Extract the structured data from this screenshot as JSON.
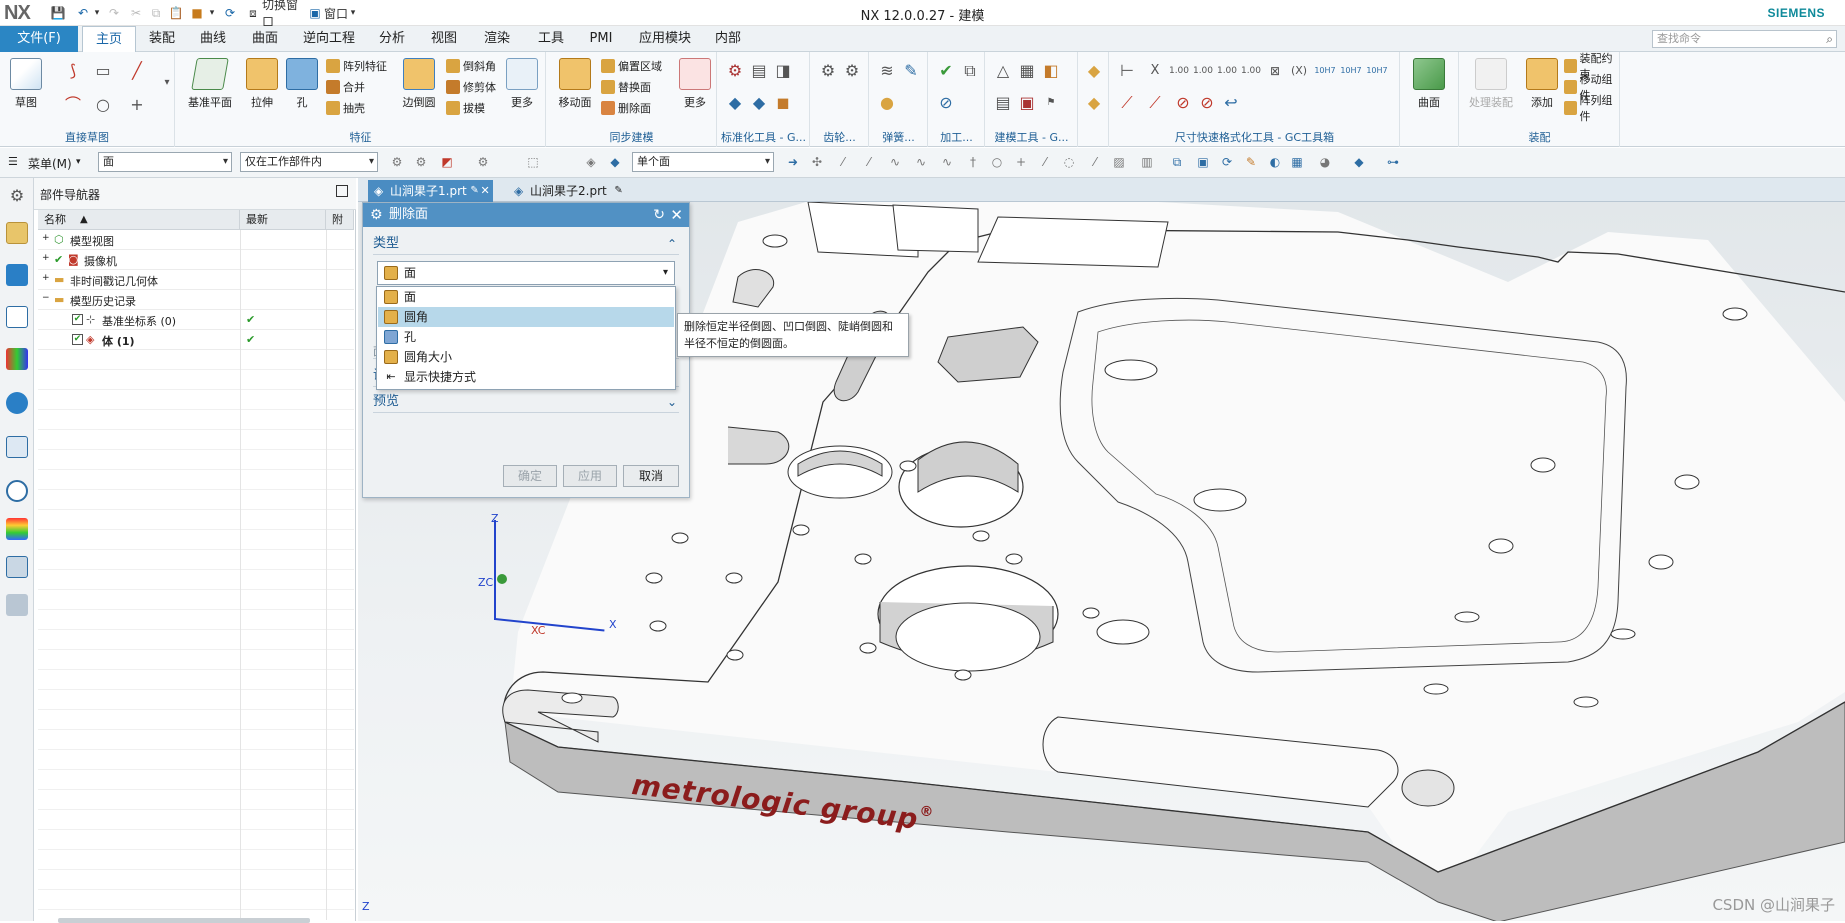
{
  "titlebar": {
    "logo": "NX",
    "switch_window": "切换窗口",
    "window": "窗口",
    "title": "NX 12.0.0.27 - 建模",
    "brand": "SIEMENS"
  },
  "menubar": {
    "file": "文件(F)",
    "tabs": [
      "主页",
      "装配",
      "曲线",
      "曲面",
      "逆向工程",
      "分析",
      "视图",
      "渲染",
      "工具",
      "PMI",
      "应用模块",
      "内部"
    ],
    "search_placeholder": "查找命令"
  },
  "ribbon": {
    "direct_sketch": {
      "label": "直接草图",
      "sketch": "草图"
    },
    "feature": {
      "label": "特征",
      "datum_plane": "基准平面",
      "extrude": "拉伸",
      "hole": "孔",
      "pattern_feature": "阵列特征",
      "unite": "合并",
      "shell": "抽壳",
      "edge_blend": "边倒圆",
      "chamfer": "倒斜角",
      "trim_body": "修剪体",
      "draft": "拔模",
      "more": "更多"
    },
    "sync": {
      "label": "同步建模",
      "move_face": "移动面",
      "offset_region": "偏置区域",
      "replace_face": "替换面",
      "delete_face": "删除面",
      "more": "更多"
    },
    "groups": [
      "标准化工具 - G...",
      "齿轮...",
      "弹簧...",
      "加工...",
      "建模工具 - G...",
      "尺寸快速格式化工具 - GC工具箱"
    ],
    "surface": "曲面",
    "assembly": {
      "label": "装配",
      "process_assembly": "处理装配",
      "add": "添加",
      "assembly_constraint": "装配约束",
      "move_component": "移动组件",
      "pattern_component": "阵列组件"
    }
  },
  "secbar": {
    "menu": "菜单(M)",
    "filter": "面",
    "scope": "仅在工作部件内",
    "face_rule": "单个面"
  },
  "navigator": {
    "title": "部件导航器",
    "columns": [
      "名称",
      "最新",
      "附"
    ],
    "rows": [
      {
        "label": "模型视图"
      },
      {
        "label": "摄像机"
      },
      {
        "label": "非时间戳记几何体"
      },
      {
        "label": "模型历史记录"
      },
      {
        "label": "基准坐标系 (0)"
      },
      {
        "label": "体 (1)"
      }
    ]
  },
  "filetabs": [
    "山涧果子1.prt",
    "山涧果子2.prt"
  ],
  "dialog": {
    "title": "删除面",
    "type_section": "类型",
    "type_value": "面",
    "hidden_section": "面",
    "settings": "设置",
    "preview": "预览",
    "ok": "确定",
    "apply": "应用",
    "cancel": "取消"
  },
  "dropdown": {
    "options": [
      "面",
      "圆角",
      "孔",
      "圆角大小",
      "显示快捷方式"
    ]
  },
  "tooltip": {
    "text": "删除恒定半径倒圆、凹口倒圆、陡峭倒圆和半径不恒定的倒圆面。"
  },
  "viewport": {
    "logo_text": "metrologic group",
    "registered": "®",
    "axis_z": "Z",
    "axis_zc": "ZC",
    "axis_x": "X",
    "axis_xc": "XC",
    "axis_z2": "Z"
  },
  "watermark": "CSDN @山涧果子",
  "colors": {
    "accent": "#2b86c4",
    "dialog_title": "#5191c4",
    "selected_option": "#b7d8ea",
    "logo_red": "#8b1c1c"
  }
}
